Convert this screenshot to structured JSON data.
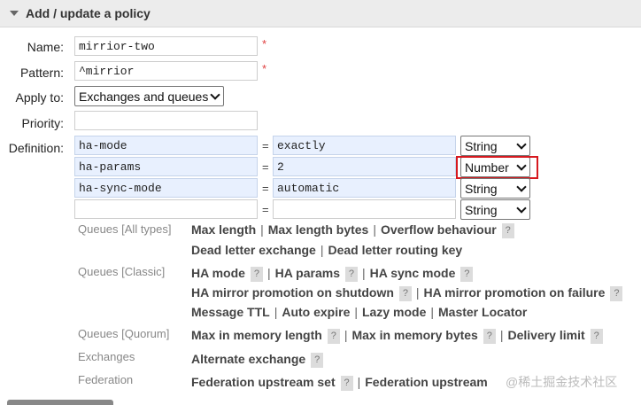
{
  "header": {
    "title": "Add / update a policy"
  },
  "form": {
    "name_label": "Name:",
    "name_value": "mirrior-two",
    "pattern_label": "Pattern:",
    "pattern_value": "^mirrior",
    "required_mark": "*",
    "apply_to_label": "Apply to:",
    "apply_to_value": "Exchanges and queues",
    "priority_label": "Priority:",
    "priority_value": "",
    "definition_label": "Definition:",
    "definition_rows": [
      {
        "key": "ha-mode",
        "eq": "=",
        "value": "exactly",
        "type": "String"
      },
      {
        "key": "ha-params",
        "eq": "=",
        "value": "2",
        "type": "Number"
      },
      {
        "key": "ha-sync-mode",
        "eq": "=",
        "value": "automatic",
        "type": "String"
      },
      {
        "key": "",
        "eq": "=",
        "value": "",
        "type": "String"
      }
    ]
  },
  "hints": {
    "queues_all": {
      "category": "Queues [All types]",
      "line1": [
        "Max length",
        "Max length bytes",
        "Overflow behaviour"
      ],
      "line2": [
        "Dead letter exchange",
        "Dead letter routing key"
      ]
    },
    "queues_classic": {
      "category": "Queues [Classic]",
      "line1": [
        "HA mode",
        "HA params",
        "HA sync mode"
      ],
      "line2": [
        "HA mirror promotion on shutdown",
        "HA mirror promotion on failure"
      ],
      "line3": [
        "Message TTL",
        "Auto expire",
        "Lazy mode",
        "Master Locator"
      ]
    },
    "queues_quorum": {
      "category": "Queues [Quorum]",
      "line1": [
        "Max in memory length",
        "Max in memory bytes",
        "Delivery limit"
      ]
    },
    "exchanges": {
      "category": "Exchanges",
      "line1": [
        "Alternate exchange"
      ]
    },
    "federation": {
      "category": "Federation",
      "line1": [
        "Federation upstream set",
        "Federation upstream"
      ]
    },
    "separator": "|",
    "help_mark": "?"
  },
  "watermark": "@稀土掘金技术社区",
  "colors": {
    "highlight_border": "#d6191f",
    "required": "#e04040",
    "autofill_bg": "#e8f0fe"
  }
}
